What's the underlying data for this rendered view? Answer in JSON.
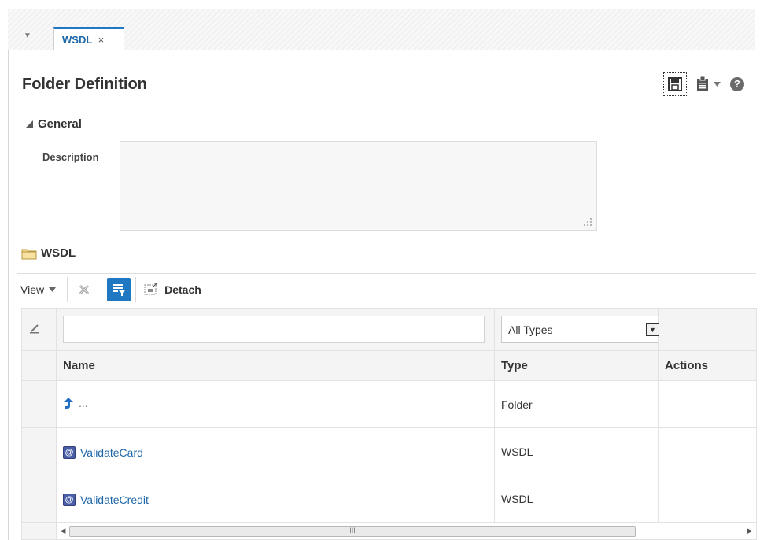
{
  "tabs": [
    {
      "label": "WSDL",
      "close": "×",
      "active": true
    }
  ],
  "page": {
    "title": "Folder Definition"
  },
  "general": {
    "header": "General",
    "description_label": "Description",
    "description_value": ""
  },
  "folder": {
    "header": "WSDL"
  },
  "toolbar": {
    "view_label": "View",
    "detach_label": "Detach"
  },
  "filter": {
    "name_value": "",
    "type_selected": "All Types"
  },
  "table": {
    "columns": {
      "name": "Name",
      "type": "Type",
      "actions": "Actions"
    },
    "rows": [
      {
        "name": "...",
        "type": "Folder",
        "icon": "up-arrow-icon"
      },
      {
        "name": "ValidateCard",
        "type": "WSDL",
        "icon": "wsdl-icon"
      },
      {
        "name": "ValidateCredit",
        "type": "WSDL",
        "icon": "wsdl-icon"
      }
    ]
  },
  "colors": {
    "accent": "#1f78c1",
    "link": "#1f67a8"
  },
  "glyphs": {
    "at": "@",
    "help": "?",
    "scroll_left": "◀",
    "scroll_right": "▶",
    "scroll_grip": "III",
    "tab_menu": "▼",
    "dropdown": "▼"
  }
}
